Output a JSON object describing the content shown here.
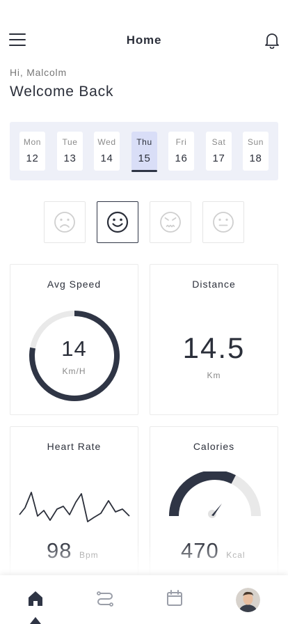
{
  "header": {
    "title": "Home",
    "menu_icon": "hamburger-menu-icon",
    "notification_icon": "bell-icon"
  },
  "greeting": {
    "hello": "Hi, Malcolm",
    "welcome": "Welcome Back"
  },
  "week": {
    "days": [
      {
        "name": "Mon",
        "date": "12"
      },
      {
        "name": "Tue",
        "date": "13"
      },
      {
        "name": "Wed",
        "date": "14"
      },
      {
        "name": "Thu",
        "date": "15"
      },
      {
        "name": "Fri",
        "date": "16"
      },
      {
        "name": "Sat",
        "date": "17"
      },
      {
        "name": "Sun",
        "date": "18"
      }
    ],
    "selected_day": "Thu"
  },
  "moods": [
    {
      "icon": "sad-face-icon",
      "selected": false
    },
    {
      "icon": "smile-face-icon",
      "selected": true
    },
    {
      "icon": "angry-face-icon",
      "selected": false
    },
    {
      "icon": "neutral-face-icon",
      "selected": false
    }
  ],
  "stats": {
    "avg_speed": {
      "title": "Avg Speed",
      "value": "14",
      "unit": "Km/H",
      "gauge_fraction": 0.78
    },
    "distance": {
      "title": "Distance",
      "value": "14.5",
      "unit": "Km"
    },
    "heart_rate": {
      "title": "Heart Rate",
      "value": "98",
      "unit": "Bpm"
    },
    "calories": {
      "title": "Calories",
      "value": "470",
      "unit": "Kcal",
      "gauge_fraction": 0.65
    }
  },
  "tabs": {
    "items": [
      "home-icon",
      "route-icon",
      "calendar-icon",
      "profile-avatar"
    ],
    "active": "home-icon"
  },
  "colors": {
    "accent": "#2f3545",
    "track": "#e9e9e9",
    "week_bg": "#eef0f8",
    "selected_day_bg": "#d9def7"
  }
}
